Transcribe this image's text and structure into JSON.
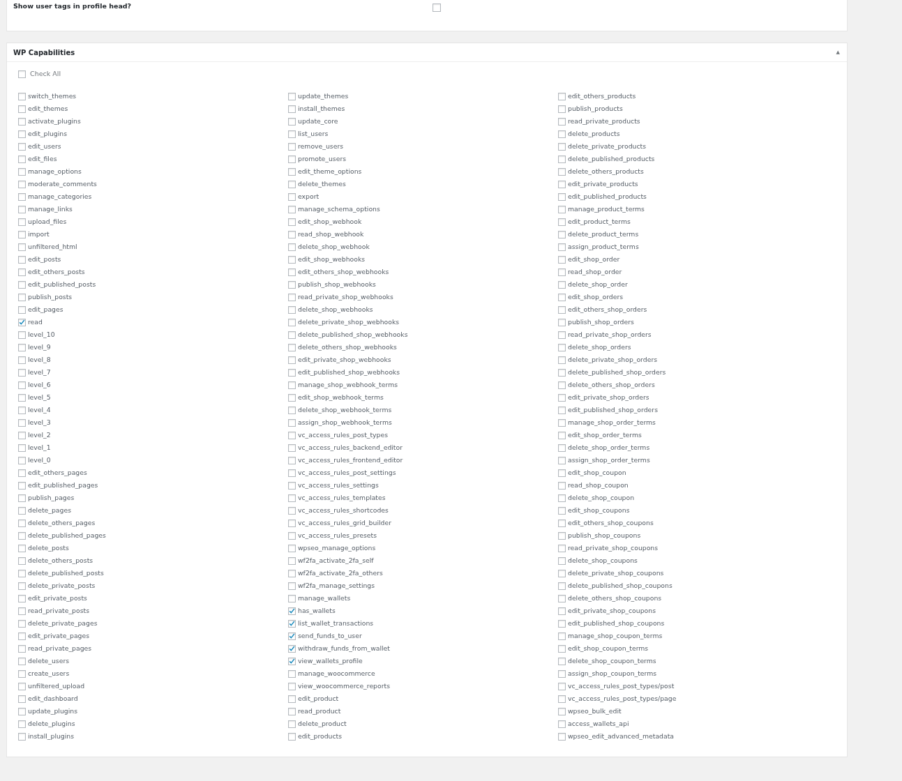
{
  "profile_settings": {
    "label": "Show user tags in profile head?",
    "checked": false
  },
  "capabilities_panel": {
    "title": "WP Capabilities",
    "expanded": true,
    "toggle": "▲",
    "check_all": {
      "label": "Check All",
      "checked": false
    },
    "columns": [
      [
        {
          "label": "switch_themes",
          "checked": false
        },
        {
          "label": "edit_themes",
          "checked": false
        },
        {
          "label": "activate_plugins",
          "checked": false
        },
        {
          "label": "edit_plugins",
          "checked": false
        },
        {
          "label": "edit_users",
          "checked": false
        },
        {
          "label": "edit_files",
          "checked": false
        },
        {
          "label": "manage_options",
          "checked": false
        },
        {
          "label": "moderate_comments",
          "checked": false
        },
        {
          "label": "manage_categories",
          "checked": false
        },
        {
          "label": "manage_links",
          "checked": false
        },
        {
          "label": "upload_files",
          "checked": false
        },
        {
          "label": "import",
          "checked": false
        },
        {
          "label": "unfiltered_html",
          "checked": false
        },
        {
          "label": "edit_posts",
          "checked": false
        },
        {
          "label": "edit_others_posts",
          "checked": false
        },
        {
          "label": "edit_published_posts",
          "checked": false
        },
        {
          "label": "publish_posts",
          "checked": false
        },
        {
          "label": "edit_pages",
          "checked": false
        },
        {
          "label": "read",
          "checked": true
        },
        {
          "label": "level_10",
          "checked": false
        },
        {
          "label": "level_9",
          "checked": false
        },
        {
          "label": "level_8",
          "checked": false
        },
        {
          "label": "level_7",
          "checked": false
        },
        {
          "label": "level_6",
          "checked": false
        },
        {
          "label": "level_5",
          "checked": false
        },
        {
          "label": "level_4",
          "checked": false
        },
        {
          "label": "level_3",
          "checked": false
        },
        {
          "label": "level_2",
          "checked": false
        },
        {
          "label": "level_1",
          "checked": false
        },
        {
          "label": "level_0",
          "checked": false
        },
        {
          "label": "edit_others_pages",
          "checked": false
        },
        {
          "label": "edit_published_pages",
          "checked": false
        },
        {
          "label": "publish_pages",
          "checked": false
        },
        {
          "label": "delete_pages",
          "checked": false
        },
        {
          "label": "delete_others_pages",
          "checked": false
        },
        {
          "label": "delete_published_pages",
          "checked": false
        },
        {
          "label": "delete_posts",
          "checked": false
        },
        {
          "label": "delete_others_posts",
          "checked": false
        },
        {
          "label": "delete_published_posts",
          "checked": false
        },
        {
          "label": "delete_private_posts",
          "checked": false
        },
        {
          "label": "edit_private_posts",
          "checked": false
        },
        {
          "label": "read_private_posts",
          "checked": false
        },
        {
          "label": "delete_private_pages",
          "checked": false
        },
        {
          "label": "edit_private_pages",
          "checked": false
        },
        {
          "label": "read_private_pages",
          "checked": false
        },
        {
          "label": "delete_users",
          "checked": false
        },
        {
          "label": "create_users",
          "checked": false
        },
        {
          "label": "unfiltered_upload",
          "checked": false
        },
        {
          "label": "edit_dashboard",
          "checked": false
        },
        {
          "label": "update_plugins",
          "checked": false
        },
        {
          "label": "delete_plugins",
          "checked": false
        },
        {
          "label": "install_plugins",
          "checked": false
        }
      ],
      [
        {
          "label": "update_themes",
          "checked": false
        },
        {
          "label": "install_themes",
          "checked": false
        },
        {
          "label": "update_core",
          "checked": false
        },
        {
          "label": "list_users",
          "checked": false
        },
        {
          "label": "remove_users",
          "checked": false
        },
        {
          "label": "promote_users",
          "checked": false
        },
        {
          "label": "edit_theme_options",
          "checked": false
        },
        {
          "label": "delete_themes",
          "checked": false
        },
        {
          "label": "export",
          "checked": false
        },
        {
          "label": "manage_schema_options",
          "checked": false
        },
        {
          "label": "edit_shop_webhook",
          "checked": false
        },
        {
          "label": "read_shop_webhook",
          "checked": false
        },
        {
          "label": "delete_shop_webhook",
          "checked": false
        },
        {
          "label": "edit_shop_webhooks",
          "checked": false
        },
        {
          "label": "edit_others_shop_webhooks",
          "checked": false
        },
        {
          "label": "publish_shop_webhooks",
          "checked": false
        },
        {
          "label": "read_private_shop_webhooks",
          "checked": false
        },
        {
          "label": "delete_shop_webhooks",
          "checked": false
        },
        {
          "label": "delete_private_shop_webhooks",
          "checked": false
        },
        {
          "label": "delete_published_shop_webhooks",
          "checked": false
        },
        {
          "label": "delete_others_shop_webhooks",
          "checked": false
        },
        {
          "label": "edit_private_shop_webhooks",
          "checked": false
        },
        {
          "label": "edit_published_shop_webhooks",
          "checked": false
        },
        {
          "label": "manage_shop_webhook_terms",
          "checked": false
        },
        {
          "label": "edit_shop_webhook_terms",
          "checked": false
        },
        {
          "label": "delete_shop_webhook_terms",
          "checked": false
        },
        {
          "label": "assign_shop_webhook_terms",
          "checked": false
        },
        {
          "label": "vc_access_rules_post_types",
          "checked": false
        },
        {
          "label": "vc_access_rules_backend_editor",
          "checked": false
        },
        {
          "label": "vc_access_rules_frontend_editor",
          "checked": false
        },
        {
          "label": "vc_access_rules_post_settings",
          "checked": false
        },
        {
          "label": "vc_access_rules_settings",
          "checked": false
        },
        {
          "label": "vc_access_rules_templates",
          "checked": false
        },
        {
          "label": "vc_access_rules_shortcodes",
          "checked": false
        },
        {
          "label": "vc_access_rules_grid_builder",
          "checked": false
        },
        {
          "label": "vc_access_rules_presets",
          "checked": false
        },
        {
          "label": "wpseo_manage_options",
          "checked": false
        },
        {
          "label": "wf2fa_activate_2fa_self",
          "checked": false
        },
        {
          "label": "wf2fa_activate_2fa_others",
          "checked": false
        },
        {
          "label": "wf2fa_manage_settings",
          "checked": false
        },
        {
          "label": "manage_wallets",
          "checked": false
        },
        {
          "label": "has_wallets",
          "checked": true
        },
        {
          "label": "list_wallet_transactions",
          "checked": true
        },
        {
          "label": "send_funds_to_user",
          "checked": true
        },
        {
          "label": "withdraw_funds_from_wallet",
          "checked": true
        },
        {
          "label": "view_wallets_profile",
          "checked": true
        },
        {
          "label": "manage_woocommerce",
          "checked": false
        },
        {
          "label": "view_woocommerce_reports",
          "checked": false
        },
        {
          "label": "edit_product",
          "checked": false
        },
        {
          "label": "read_product",
          "checked": false
        },
        {
          "label": "delete_product",
          "checked": false
        },
        {
          "label": "edit_products",
          "checked": false
        }
      ],
      [
        {
          "label": "edit_others_products",
          "checked": false
        },
        {
          "label": "publish_products",
          "checked": false
        },
        {
          "label": "read_private_products",
          "checked": false
        },
        {
          "label": "delete_products",
          "checked": false
        },
        {
          "label": "delete_private_products",
          "checked": false
        },
        {
          "label": "delete_published_products",
          "checked": false
        },
        {
          "label": "delete_others_products",
          "checked": false
        },
        {
          "label": "edit_private_products",
          "checked": false
        },
        {
          "label": "edit_published_products",
          "checked": false
        },
        {
          "label": "manage_product_terms",
          "checked": false
        },
        {
          "label": "edit_product_terms",
          "checked": false
        },
        {
          "label": "delete_product_terms",
          "checked": false
        },
        {
          "label": "assign_product_terms",
          "checked": false
        },
        {
          "label": "edit_shop_order",
          "checked": false
        },
        {
          "label": "read_shop_order",
          "checked": false
        },
        {
          "label": "delete_shop_order",
          "checked": false
        },
        {
          "label": "edit_shop_orders",
          "checked": false
        },
        {
          "label": "edit_others_shop_orders",
          "checked": false
        },
        {
          "label": "publish_shop_orders",
          "checked": false
        },
        {
          "label": "read_private_shop_orders",
          "checked": false
        },
        {
          "label": "delete_shop_orders",
          "checked": false
        },
        {
          "label": "delete_private_shop_orders",
          "checked": false
        },
        {
          "label": "delete_published_shop_orders",
          "checked": false
        },
        {
          "label": "delete_others_shop_orders",
          "checked": false
        },
        {
          "label": "edit_private_shop_orders",
          "checked": false
        },
        {
          "label": "edit_published_shop_orders",
          "checked": false
        },
        {
          "label": "manage_shop_order_terms",
          "checked": false
        },
        {
          "label": "edit_shop_order_terms",
          "checked": false
        },
        {
          "label": "delete_shop_order_terms",
          "checked": false
        },
        {
          "label": "assign_shop_order_terms",
          "checked": false
        },
        {
          "label": "edit_shop_coupon",
          "checked": false
        },
        {
          "label": "read_shop_coupon",
          "checked": false
        },
        {
          "label": "delete_shop_coupon",
          "checked": false
        },
        {
          "label": "edit_shop_coupons",
          "checked": false
        },
        {
          "label": "edit_others_shop_coupons",
          "checked": false
        },
        {
          "label": "publish_shop_coupons",
          "checked": false
        },
        {
          "label": "read_private_shop_coupons",
          "checked": false
        },
        {
          "label": "delete_shop_coupons",
          "checked": false
        },
        {
          "label": "delete_private_shop_coupons",
          "checked": false
        },
        {
          "label": "delete_published_shop_coupons",
          "checked": false
        },
        {
          "label": "delete_others_shop_coupons",
          "checked": false
        },
        {
          "label": "edit_private_shop_coupons",
          "checked": false
        },
        {
          "label": "edit_published_shop_coupons",
          "checked": false
        },
        {
          "label": "manage_shop_coupon_terms",
          "checked": false
        },
        {
          "label": "edit_shop_coupon_terms",
          "checked": false
        },
        {
          "label": "delete_shop_coupon_terms",
          "checked": false
        },
        {
          "label": "assign_shop_coupon_terms",
          "checked": false
        },
        {
          "label": "vc_access_rules_post_types/post",
          "checked": false
        },
        {
          "label": "vc_access_rules_post_types/page",
          "checked": false
        },
        {
          "label": "wpseo_bulk_edit",
          "checked": false
        },
        {
          "label": "access_wallets_api",
          "checked": false
        },
        {
          "label": "wpseo_edit_advanced_metadata",
          "checked": false
        }
      ]
    ]
  }
}
